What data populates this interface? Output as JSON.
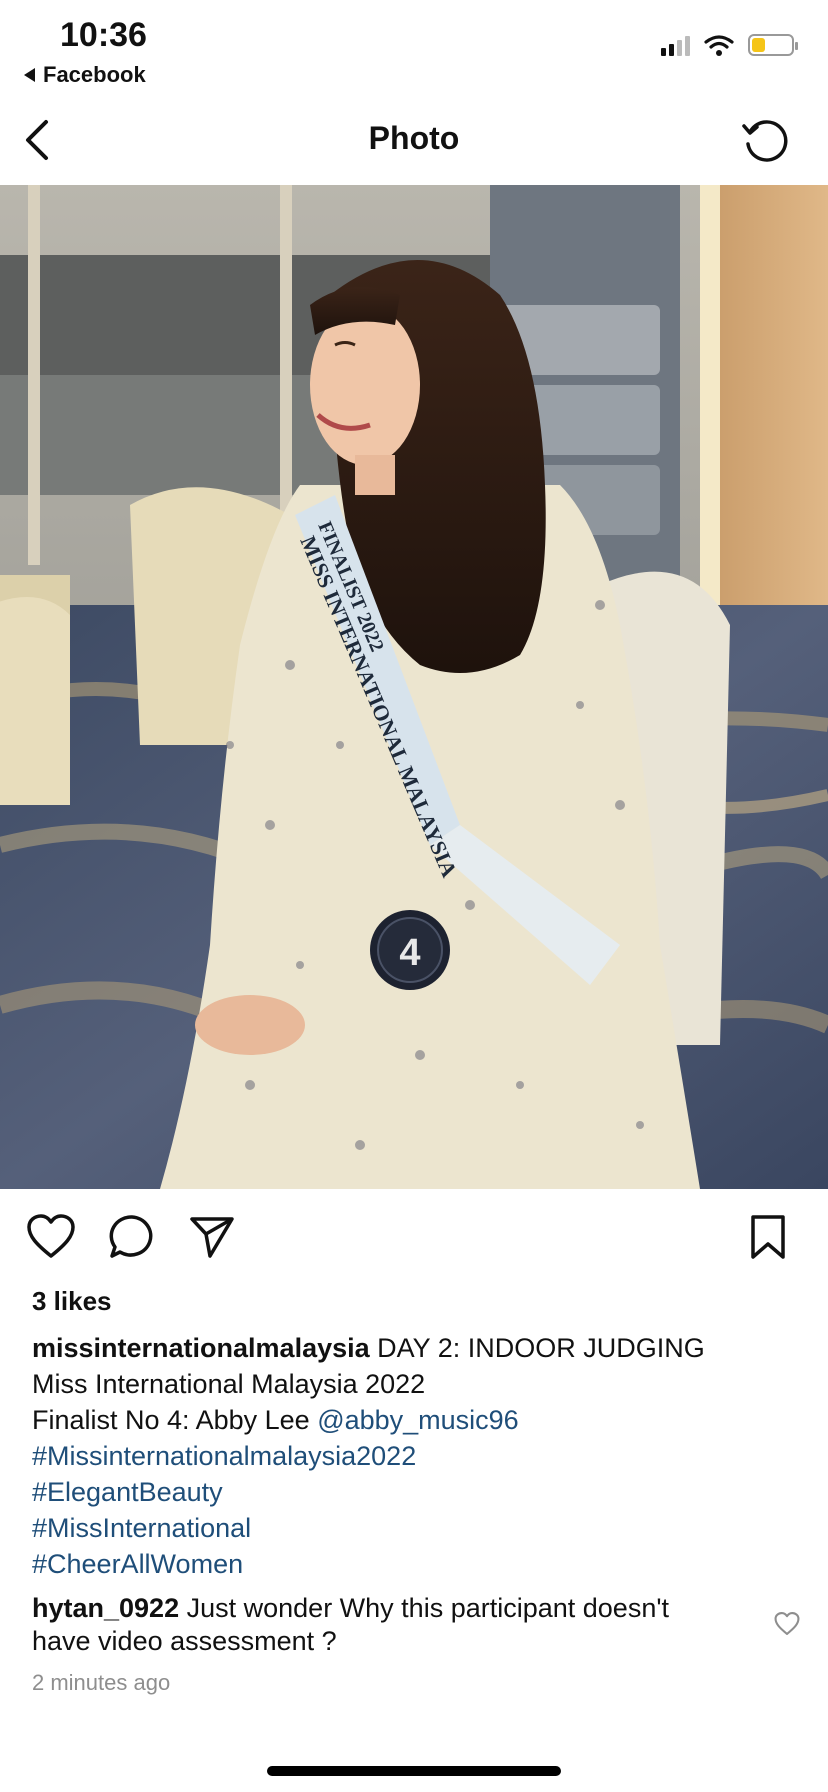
{
  "status": {
    "time": "10:36",
    "back_app": "Facebook",
    "signal_bars": 4,
    "signal_filled": 2,
    "battery_level": 0.35,
    "battery_color": "#f5c518"
  },
  "nav": {
    "title": "Photo",
    "back_icon": "chevron-left-icon",
    "refresh_icon": "refresh-icon"
  },
  "photo": {
    "sash_line1": "FINALIST 2022",
    "sash_line2": "MISS INTERNATIONAL MALAYSIA",
    "badge_number": "4"
  },
  "actions": {
    "like_icon": "heart-icon",
    "comment_icon": "comment-icon",
    "share_icon": "send-icon",
    "save_icon": "bookmark-icon"
  },
  "post": {
    "likes": "3 likes",
    "username": "missinternationalmalaysia",
    "caption_line1": "DAY 2: INDOOR JUDGING",
    "caption_line2": "Miss International Malaysia 2022",
    "caption_line3_prefix": "Finalist No 4: Abby Lee",
    "mention": "@abby_music96",
    "hashtags": [
      "#Missinternationalmalaysia2022",
      "#ElegantBeauty",
      "#MissInternational",
      "#CheerAllWomen"
    ]
  },
  "comment": {
    "username": "hytan_0922",
    "text": "Just wonder Why this participant doesn't have video assessment ?",
    "time": "2 minutes ago"
  },
  "colors": {
    "link": "#1f4e79",
    "muted": "#8e8e8e"
  }
}
